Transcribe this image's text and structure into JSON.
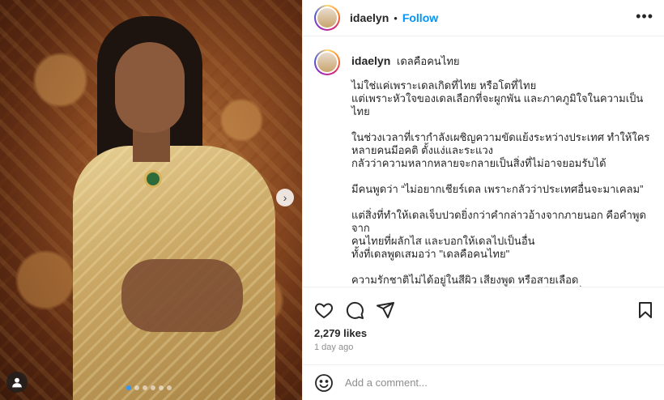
{
  "post": {
    "username": "idaelyn",
    "follow_label": "Follow",
    "separator": "•",
    "more_label": "•••",
    "caption_title": "เดลคือคนไทย",
    "caption_paragraphs": [
      "ไม่ใช่แค่เพราะเดลเกิดที่ไทย หรือโตที่ไทย\nแต่เพราะหัวใจของเดลเลือกที่จะผูกพัน และภาคภูมิใจในความเป็นไทย",
      "ในช่วงเวลาที่เรากำลังเผชิญความขัดแย้งระหว่างประเทศ ทำให้ใคร\nหลายคนมีอคติ ตั้งแง่และระแวง\nกลัวว่าความหลากหลายจะกลายเป็นสิ่งที่ไม่อาจยอมรับได้",
      "มีคนพูดว่า “ไม่อยากเชียร์เดล เพราะกลัวว่าประเทศอื่นจะมาเคลม”",
      "แต่สิ่งที่ทำให้เดลเจ็บปวดยิ่งกว่าคำกล่าวอ้างจากภายนอก คือคำพูดจาก\nคนไทยที่ผลักไส และบอกให้เดลไปเป็นอื่น\nทั้งที่เดลพูดเสมอว่า \"เดลคือคนไทย\"",
      "ความรักชาติไม่ได้อยู่ในสีผิว เสียงพูด หรือสายเลือด\nแต่มันอยู่ในหัวใจ และหัวใจของเดลไม่เคยเป็นของที่ไหนนอกจากแผ่นดิน\nไทย"
    ],
    "likes": "2,279 likes",
    "time_ago": "1 day ago",
    "comment_placeholder": "Add a comment...",
    "next_glyph": "›"
  },
  "icons": {
    "like": "heart-icon",
    "comment": "comment-icon",
    "share": "send-icon",
    "save": "bookmark-icon",
    "emoji": "emoji-icon",
    "tag": "user-tag-icon",
    "next": "chevron-right-icon"
  },
  "colors": {
    "accent": "#0095f6",
    "text": "#262626",
    "muted": "#8e8e8e",
    "border": "#efefef",
    "carousel_active": "#3897f0"
  },
  "carousel": {
    "total": 6,
    "active_index": 0
  }
}
